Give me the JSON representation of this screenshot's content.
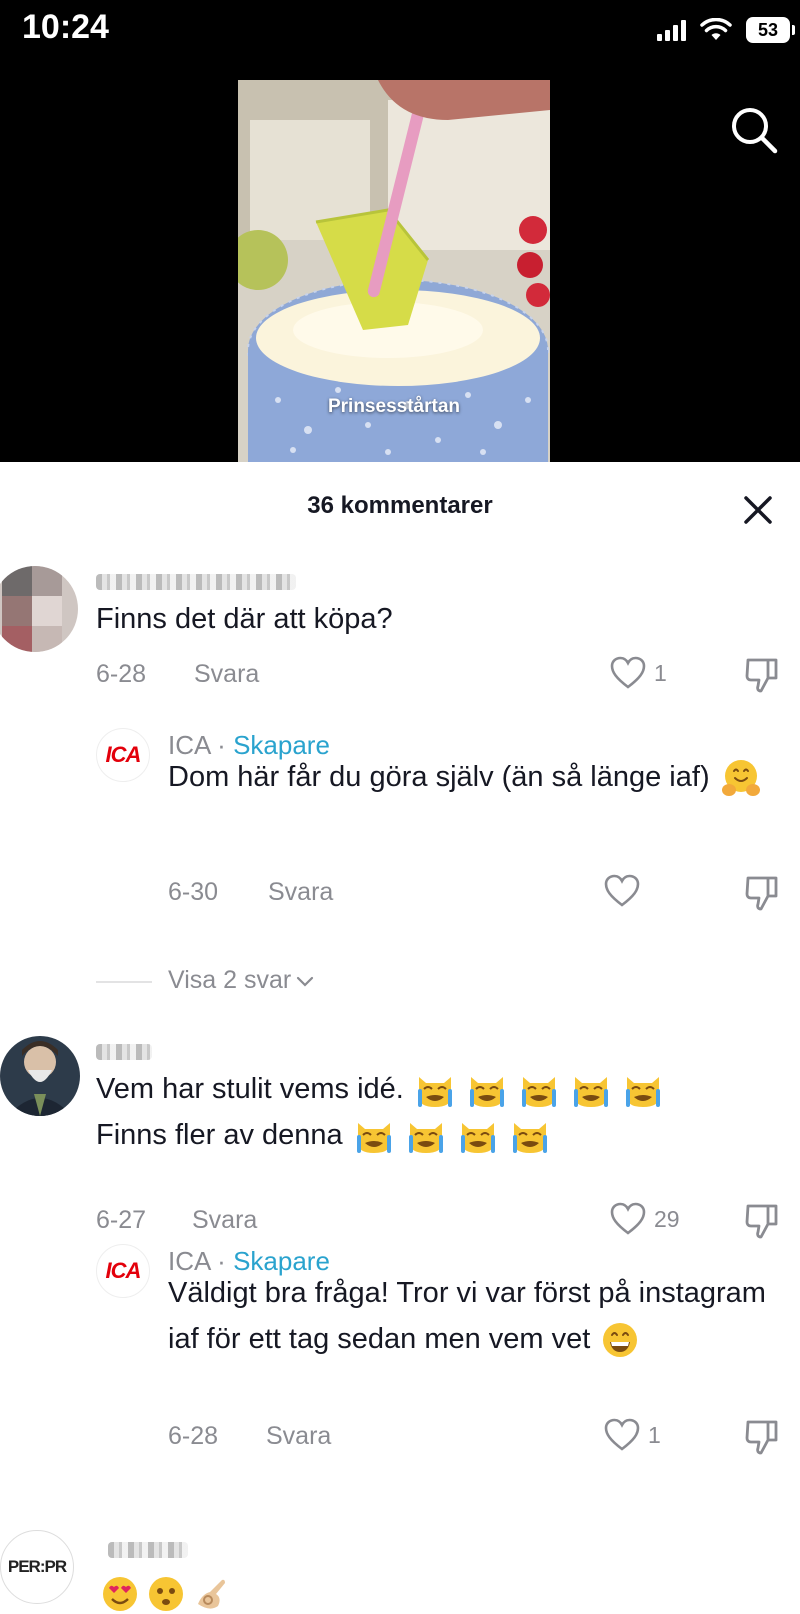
{
  "status": {
    "time": "10:24",
    "battery": "53"
  },
  "video": {
    "caption": "Prinsesstårtan"
  },
  "comments_sheet": {
    "title": "36 kommentarer",
    "comments": [
      {
        "text": "Finns det där att köpa?",
        "date": "6-28",
        "reply_label": "Svara",
        "likes": "1",
        "reply": {
          "author": "ICA",
          "separator": "·",
          "role": "Skapare",
          "text": "Dom här får du göra själv (än så länge iaf)",
          "date": "6-30",
          "reply_label": "Svara"
        },
        "show_replies": "Visa 2 svar"
      },
      {
        "text_line1": "Vem har stulit vems idé.",
        "text_line2": "Finns fler av denna",
        "date": "6-27",
        "reply_label": "Svara",
        "likes": "29",
        "reply": {
          "author": "ICA",
          "separator": "·",
          "role": "Skapare",
          "text": "Väldigt bra fråga! Tror vi var först på instagram iaf för ett tag sedan men vem vet",
          "date": "6-28",
          "reply_label": "Svara",
          "likes": "1"
        }
      },
      {
        "avatar_text": "PER:PR"
      }
    ]
  },
  "logo": {
    "text": "ICA",
    "color": "#e3000b"
  },
  "colors": {
    "creator_accent": "#2aa3ce",
    "muted": "#8a8b91"
  }
}
